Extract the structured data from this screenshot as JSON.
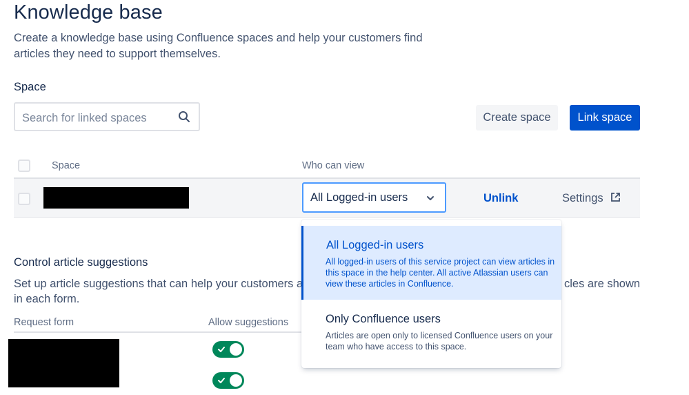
{
  "header": {
    "title": "Knowledge base",
    "description": "Create a knowledge base using Confluence spaces and help your customers find articles they need to support themselves."
  },
  "space_section": {
    "title": "Space",
    "search_placeholder": "Search for linked spaces",
    "create_button": "Create space",
    "link_button": "Link space"
  },
  "table": {
    "col_space": "Space",
    "col_who": "Who can view",
    "row": {
      "who_value": "All Logged-in users",
      "unlink": "Unlink",
      "settings": "Settings"
    }
  },
  "dropdown": {
    "options": [
      {
        "title": "All Logged-in users",
        "description": "All logged-in users of this service project can view articles in this space in the help center. All active Atlassian users can view these articles in Confluence."
      },
      {
        "title": "Only Confluence users",
        "description": "Articles are open only to licensed Confluence users on your team who have access to this space."
      }
    ]
  },
  "suggestions": {
    "title": "Control article suggestions",
    "desc_left": "Set up article suggestions that can help your customers as t",
    "desc_right": "cles are shown",
    "desc_line2": "in each form.",
    "col_form": "Request form",
    "col_allow": "Allow suggestions",
    "toggles": [
      true,
      true
    ]
  },
  "colors": {
    "primary": "#0052cc",
    "toggle_on": "#00875a",
    "selected_bg": "#deebff"
  }
}
